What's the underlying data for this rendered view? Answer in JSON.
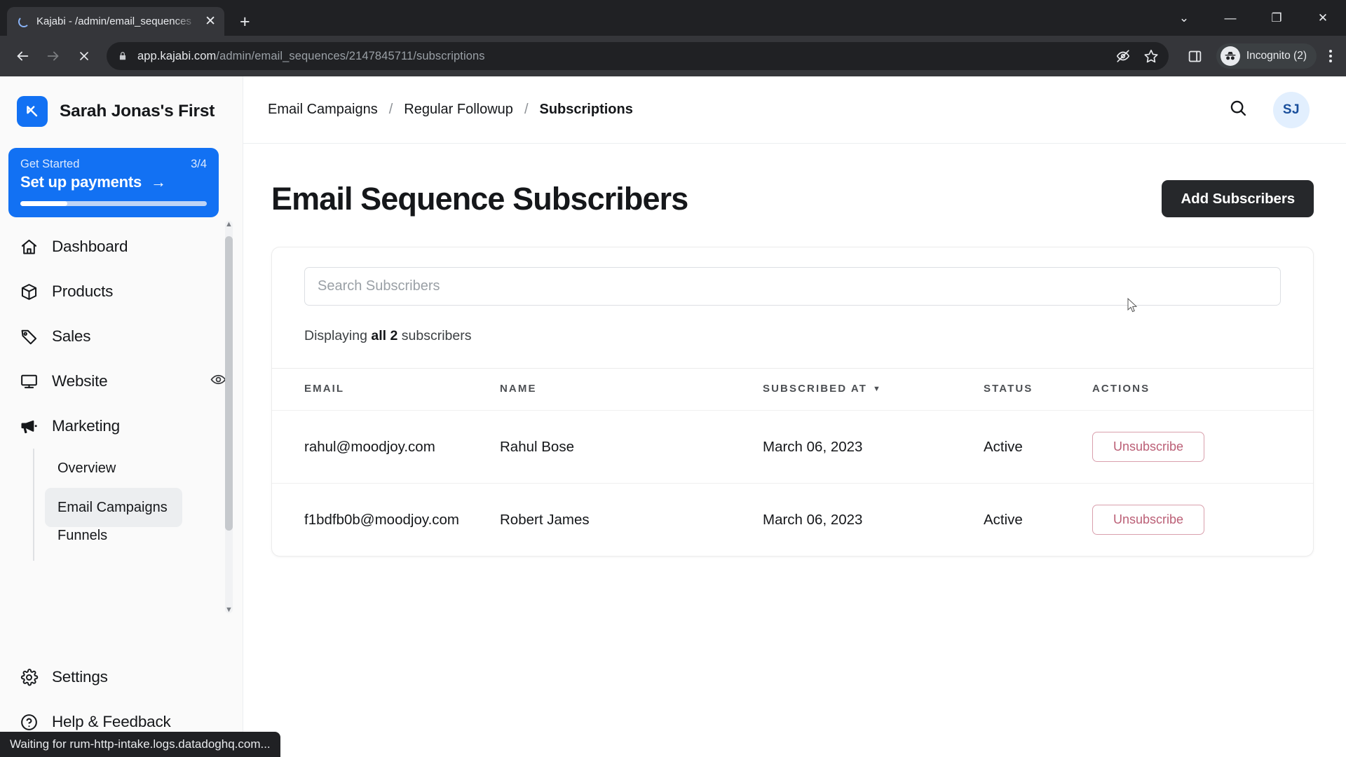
{
  "browser": {
    "tab": {
      "title": "Kajabi - /admin/email_sequences",
      "close_label": "✕",
      "spinner_icon": "loading-spinner-icon"
    },
    "new_tab_label": "+",
    "window_controls": {
      "minimize_caret": "⌄",
      "minimize": "—",
      "maximize": "❐",
      "close": "✕"
    },
    "nav": {
      "back": "←",
      "forward": "→",
      "stop": "✕"
    },
    "url": {
      "domain": "app.kajabi.com",
      "path": "/admin/email_sequences/2147845711/subscriptions"
    },
    "omnibox_icons": [
      "eye-slash-icon",
      "star-icon"
    ],
    "side_panel_icon": "side-panel-icon",
    "profile": {
      "label": "Incognito (2)",
      "icon": "incognito-hat-icon"
    },
    "menu_icon": "three-dot-menu-icon",
    "status_text": "Waiting for rum-http-intake.logs.datadoghq.com..."
  },
  "sidebar": {
    "brand": {
      "name": "Sarah Jonas's First",
      "logo_icon": "kajabi-logo-icon",
      "logo_color": "#1271f3"
    },
    "get_started": {
      "label": "Get Started",
      "progress_text": "3/4",
      "cta": "Set up payments",
      "arrow": "→",
      "progress_percent": 25,
      "bg_color": "#1271f3"
    },
    "items": [
      {
        "label": "Dashboard",
        "icon": "home-icon"
      },
      {
        "label": "Products",
        "icon": "box-icon"
      },
      {
        "label": "Sales",
        "icon": "tag-icon"
      },
      {
        "label": "Website",
        "icon": "monitor-icon",
        "trailing_icon": "eye-icon"
      },
      {
        "label": "Marketing",
        "icon": "megaphone-icon"
      }
    ],
    "marketing_subitems": [
      {
        "label": "Overview",
        "active": false
      },
      {
        "label": "Email Campaigns",
        "active": true
      },
      {
        "label": "Funnels",
        "active": false
      }
    ],
    "bottom_items": [
      {
        "label": "Settings",
        "icon": "gear-icon"
      },
      {
        "label": "Help & Feedback",
        "icon": "question-circle-icon"
      }
    ],
    "scrollbar": {
      "up_arrow": "▲",
      "down_arrow": "▼"
    }
  },
  "topbar": {
    "breadcrumb": [
      {
        "label": "Email Campaigns",
        "current": false
      },
      {
        "label": "Regular Followup",
        "current": false
      },
      {
        "label": "Subscriptions",
        "current": true
      }
    ],
    "separator": "/",
    "search_icon": "search-icon",
    "avatar_initials": "SJ"
  },
  "page": {
    "title": "Email Sequence Subscribers",
    "primary_button": "Add Subscribers",
    "search": {
      "placeholder": "Search Subscribers",
      "value": ""
    },
    "displaying": {
      "prefix": "Displaying ",
      "emphasis": "all 2",
      "suffix": " subscribers"
    }
  },
  "table": {
    "columns": [
      "EMAIL",
      "NAME",
      "SUBSCRIBED AT",
      "STATUS",
      "ACTIONS"
    ],
    "sort_column": "SUBSCRIBED AT",
    "sort_caret": "▼",
    "rows": [
      {
        "email": "rahul@moodjoy.com",
        "name": "Rahul Bose",
        "subscribed_at": "March 06, 2023",
        "status": "Active",
        "action": "Unsubscribe"
      },
      {
        "email": "f1bdfb0b@moodjoy.com",
        "name": "Robert James",
        "subscribed_at": "March 06, 2023",
        "status": "Active",
        "action": "Unsubscribe"
      }
    ]
  },
  "colors": {
    "accent_blue": "#1271f3",
    "button_dark": "#26282b",
    "unsubscribe_border": "#d9a0ad",
    "unsubscribe_text": "#bb5f76",
    "avatar_bg": "#e2effe"
  }
}
